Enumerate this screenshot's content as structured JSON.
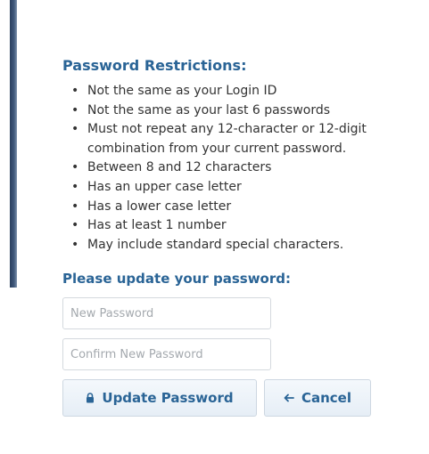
{
  "restrictions": {
    "title": "Password Restrictions:",
    "items": [
      "Not the same as your Login ID",
      "Not the same as your last 6 passwords",
      "Must not repeat any 12-character or 12-digit combination from your current password.",
      "Between 8 and 12 characters",
      "Has an upper case letter",
      "Has a lower case letter",
      "Has at least 1 number",
      "May include standard special characters."
    ]
  },
  "form": {
    "title": "Please update your password:",
    "new_password_placeholder": "New Password",
    "confirm_password_placeholder": "Confirm New Password",
    "update_label": "Update Password",
    "cancel_label": "Cancel"
  },
  "icons": {
    "update": "lock-icon",
    "cancel": "arrow-left-icon"
  },
  "colors": {
    "heading": "#2a6496",
    "text": "#333333",
    "button_bg": "#e9f0f7",
    "left_bar": "#41597c"
  }
}
